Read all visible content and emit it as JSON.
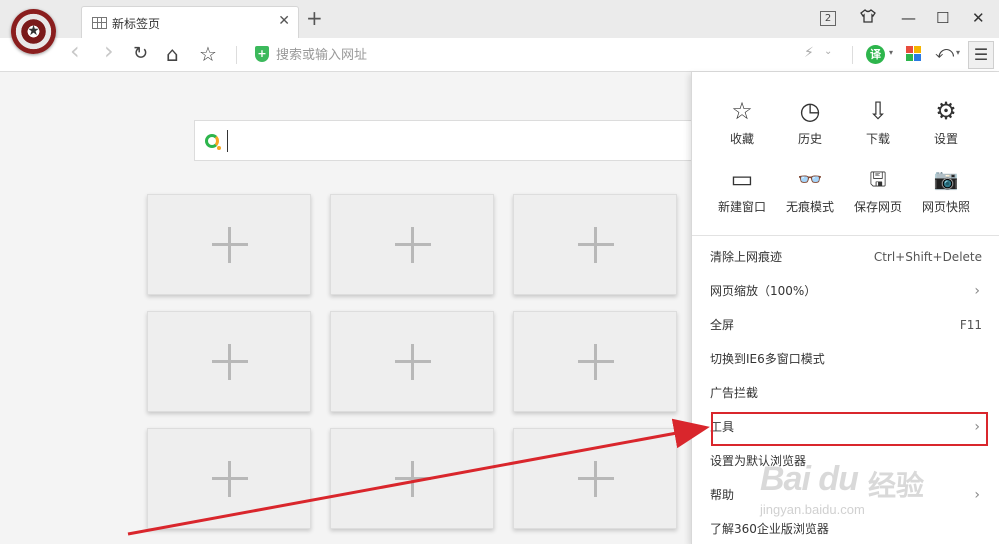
{
  "titlebar": {
    "tab_title": "新标签页",
    "tab_close": "✕",
    "new_tab": "+",
    "tab_count": "2",
    "skin_icon": "shirt-icon",
    "minimize": "—",
    "maximize": "☐",
    "close": "✕"
  },
  "toolbar": {
    "back": "‹",
    "forward": "›",
    "refresh": "↻",
    "home": "⌂",
    "bookmark": "☆",
    "address_placeholder": "搜索或输入网址",
    "shield_glyph": "+",
    "bolt": "⚡",
    "bolt_dd": "⌄",
    "translate": "译",
    "dd": "▾",
    "undo": "⤺",
    "menu": "☰"
  },
  "search": {
    "placeholder": ""
  },
  "tiles": [
    "",
    "",
    "",
    "",
    "",
    "",
    "",
    "",
    ""
  ],
  "menu": {
    "quick_actions": [
      {
        "label": "收藏",
        "icon": "star-icon",
        "glyph": "☆"
      },
      {
        "label": "历史",
        "icon": "clock-icon",
        "glyph": "◷"
      },
      {
        "label": "下载",
        "icon": "download-icon",
        "glyph": "⇩"
      },
      {
        "label": "设置",
        "icon": "gear-icon",
        "glyph": "⚙"
      },
      {
        "label": "新建窗口",
        "icon": "window-icon",
        "glyph": "▭"
      },
      {
        "label": "无痕模式",
        "icon": "incognito-icon",
        "glyph": "👓"
      },
      {
        "label": "保存网页",
        "icon": "save-icon",
        "glyph": "🖫"
      },
      {
        "label": "网页快照",
        "icon": "camera-icon",
        "glyph": "📷"
      }
    ],
    "items": [
      {
        "label": "清除上网痕迹",
        "shortcut": "Ctrl+Shift+Delete",
        "arrow": ""
      },
      {
        "label": "网页缩放（100%）",
        "shortcut": "",
        "arrow": "›"
      },
      {
        "label": "全屏",
        "shortcut": "F11",
        "arrow": ""
      },
      {
        "label": "切换到IE6多窗口模式",
        "shortcut": "",
        "arrow": ""
      },
      {
        "label": "广告拦截",
        "shortcut": "",
        "arrow": ""
      },
      {
        "label": "工具",
        "shortcut": "",
        "arrow": "›"
      },
      {
        "label": "设置为默认浏览器",
        "shortcut": "",
        "arrow": ""
      },
      {
        "label": "帮助",
        "shortcut": "",
        "arrow": "›"
      },
      {
        "label": "了解360企业版浏览器",
        "shortcut": "",
        "arrow": ""
      }
    ]
  },
  "watermark": {
    "brand": "Bai du",
    "text": "经验",
    "url": "jingyan.baidu.com"
  },
  "colors": {
    "accent_green": "#2db54c",
    "highlight_red": "#d9262c"
  }
}
